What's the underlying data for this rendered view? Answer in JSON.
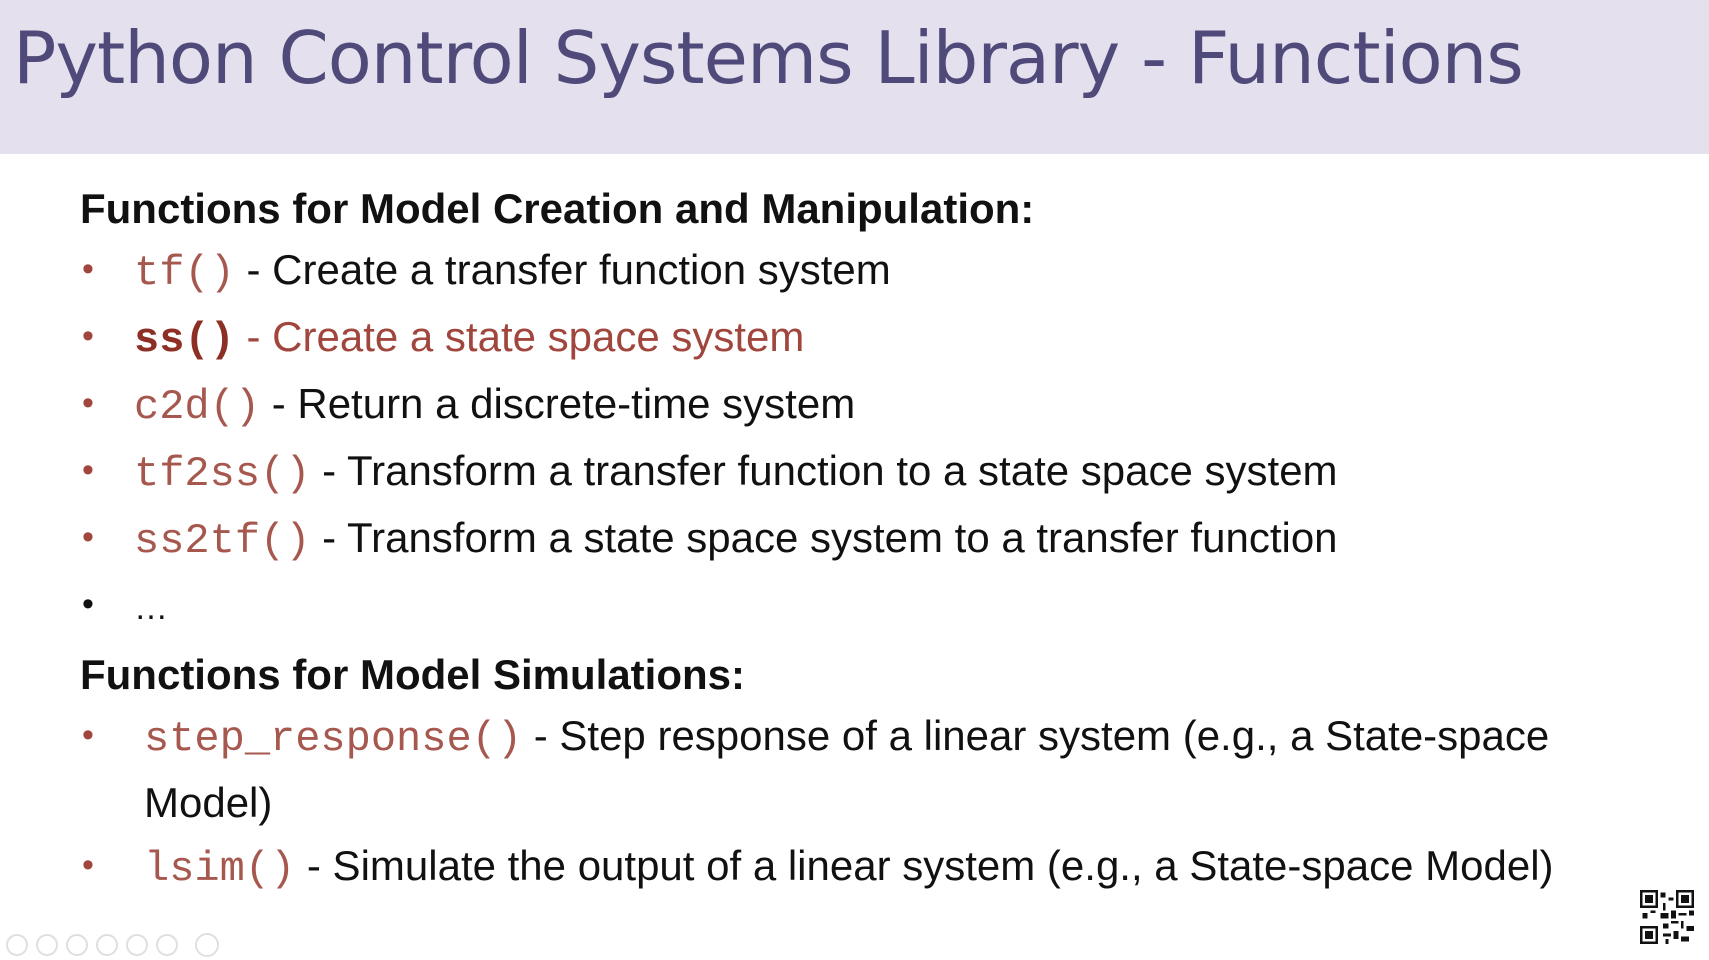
{
  "title": "Python Control Systems Library - Functions",
  "section_creation": {
    "heading": "Functions for Model Creation and Manipulation:",
    "items": [
      {
        "code": "tf()",
        "desc": "- Create a transfer function system"
      },
      {
        "code": "ss()",
        "desc": "- Create a state space system"
      },
      {
        "code": "c2d()",
        "desc": "- Return a discrete-time system"
      },
      {
        "code": "tf2ss()",
        "desc": "- Transform a transfer function to a state space system"
      },
      {
        "code": "ss2tf()",
        "desc": "- Transform a state space system to a transfer function"
      },
      {
        "code": "",
        "desc": "…"
      }
    ]
  },
  "section_simulation": {
    "heading": "Functions for Model Simulations:",
    "items": [
      {
        "code": "step_response()",
        "desc": "- Step response of a linear system (e.g., a State-space Model)"
      },
      {
        "code": "lsim()",
        "desc": "- Simulate the output of a linear system (e.g., a State-space Model)"
      }
    ]
  },
  "colors": {
    "title_bar": "#e4e0ed",
    "title_text": "#4f4a79",
    "code_text": "#a6574e",
    "highlight": "#a0463d"
  },
  "icons": [
    "qr-code-icon",
    "slide-toolbar-icons"
  ]
}
